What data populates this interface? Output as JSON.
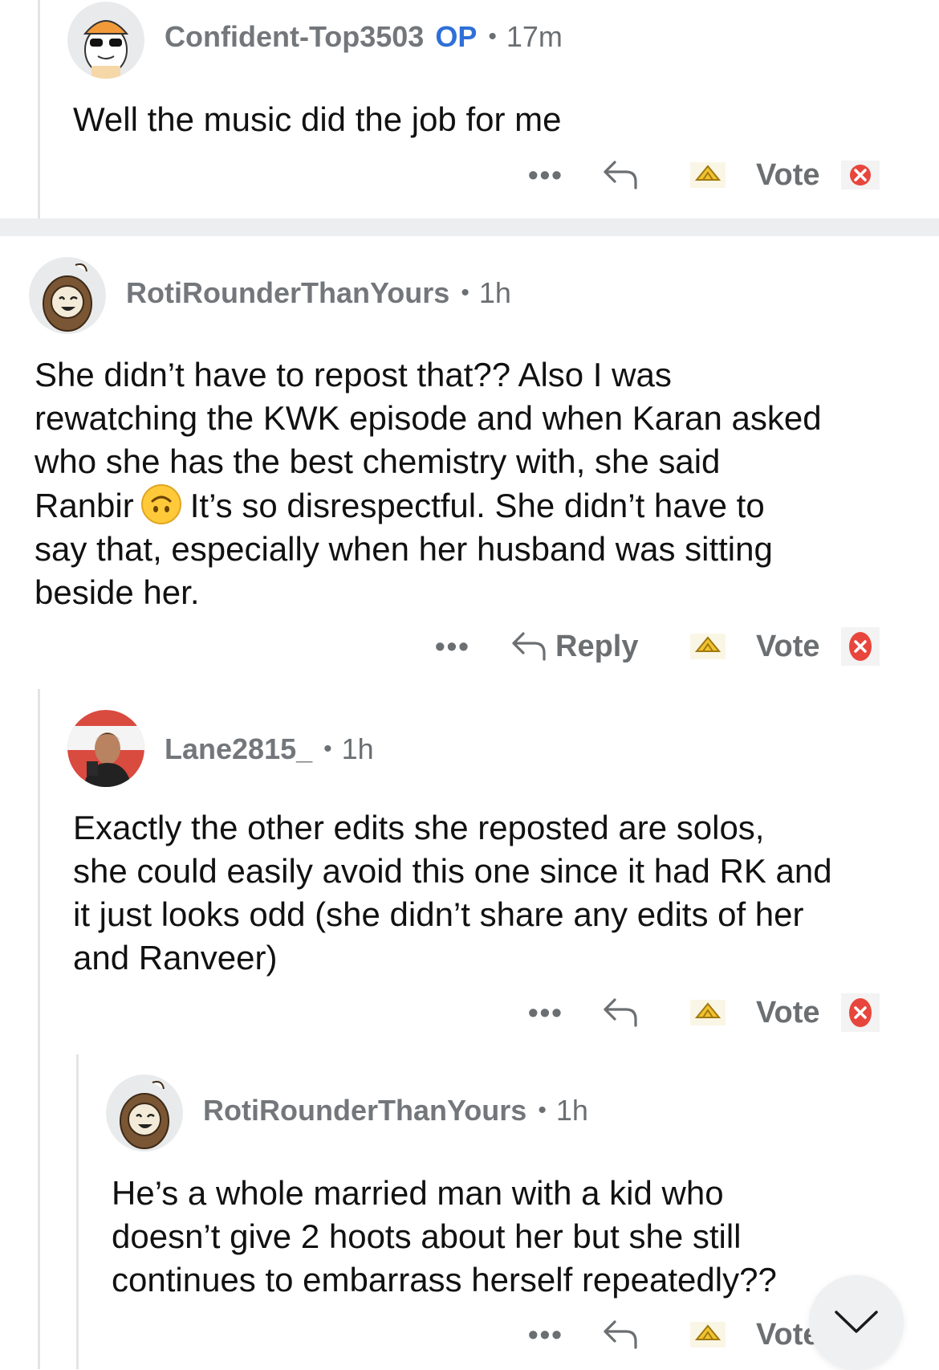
{
  "comments": [
    {
      "user": "Confident-Top3503",
      "op_badge": "OP",
      "time": "17m",
      "body": "Well the music did the job for me",
      "actions": {
        "more": "•••",
        "vote": "Vote"
      }
    },
    {
      "user": "RotiRounderThanYours",
      "time": "1h",
      "body_lines": [
        "She didn’t have to repost that?? Also I was",
        "rewatching the KWK episode and when Karan asked",
        "who she has the best chemistry with, she said",
        "Ranbir",
        "It’s so disrespectful. She didn’t have to",
        "say that, especially when her husband was sitting",
        "beside her."
      ],
      "actions": {
        "more": "•••",
        "reply": "Reply",
        "vote": "Vote"
      }
    },
    {
      "user": "Lane2815_",
      "time": "1h",
      "body_lines": [
        "Exactly the other edits she reposted are solos,",
        "she could easily avoid this one since it had RK and",
        "it just looks odd (she didn’t share any edits of her",
        "and Ranveer)"
      ],
      "actions": {
        "more": "•••",
        "vote": "Vote"
      }
    },
    {
      "user": "RotiRounderThanYours",
      "time": "1h",
      "body_lines": [
        "He’s a whole married man with a kid who",
        "doesn’t give 2 hoots about her but she still",
        "continues to embarrass herself repeatedly??"
      ],
      "actions": {
        "more": "•••",
        "vote": "Vote"
      }
    }
  ],
  "separator": "•",
  "icons": {
    "reply": "reply-arrow-icon",
    "award": "gold-award-icon",
    "downvote": "red-x-icon",
    "emoji": "upside-down-face-emoji",
    "scroll": "chevron-down-icon"
  },
  "colors": {
    "op": "#2f6fd8",
    "meta": "#6b6f72",
    "downvote": "#e8463c",
    "award": "#f2c230"
  }
}
